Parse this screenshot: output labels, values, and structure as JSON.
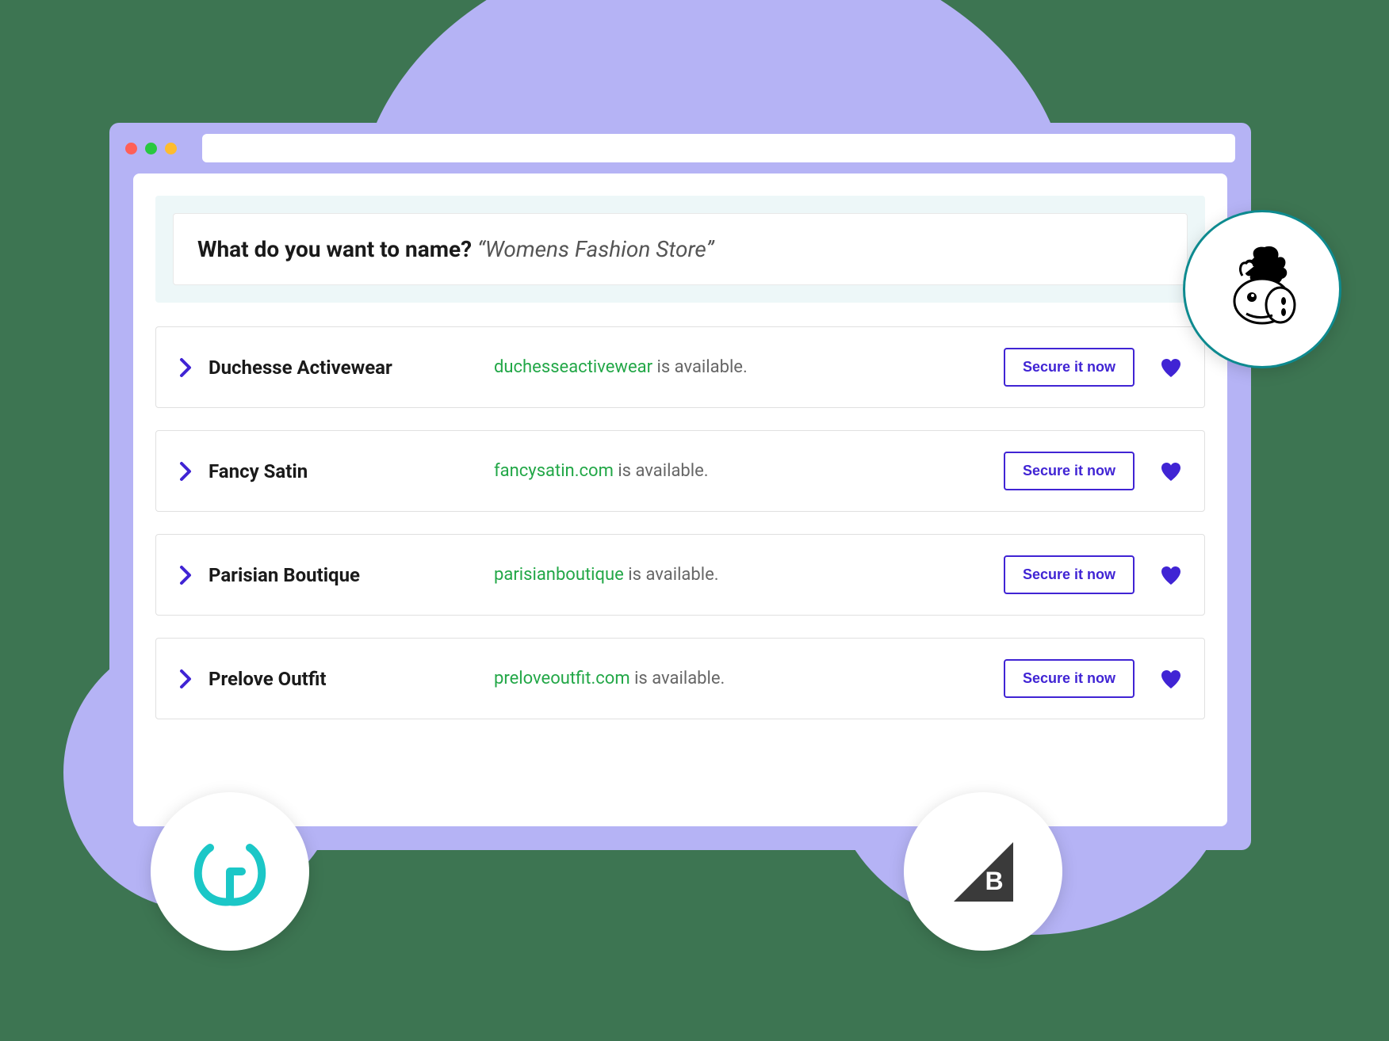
{
  "search": {
    "prompt_label": "What do you want to name?",
    "prompt_value": "“Womens Fashion Store”"
  },
  "results": [
    {
      "name": "Duchesse Activewear",
      "domain": "duchesseactivewear",
      "availability_suffix": " is available.",
      "cta": "Secure it now"
    },
    {
      "name": "Fancy Satin",
      "domain": "fancysatin.com",
      "availability_suffix": " is available.",
      "cta": "Secure it now"
    },
    {
      "name": "Parisian Boutique",
      "domain": "parisianboutique",
      "availability_suffix": " is available.",
      "cta": "Secure it now"
    },
    {
      "name": "Prelove Outfit",
      "domain": "preloveoutfit.com",
      "availability_suffix": " is available.",
      "cta": "Secure it now"
    }
  ],
  "badges": {
    "top_right": "donkey-mascot-icon",
    "bottom_left": "godaddy-icon",
    "bottom_right": "bigcommerce-icon"
  },
  "colors": {
    "accent": "#4024d4",
    "success": "#22a747",
    "background": "#3d7552",
    "blob": "#b5b3f5"
  }
}
